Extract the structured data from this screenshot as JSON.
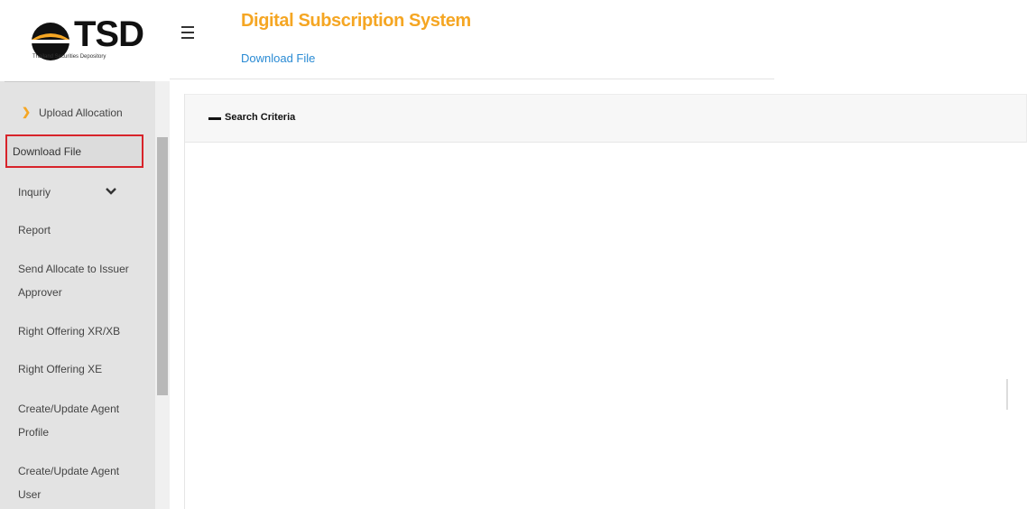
{
  "header": {
    "logo_text": "TSD",
    "logo_subtext": "Thailand Securities Depository",
    "app_title": "Digital Subscription System",
    "breadcrumb": "Download File"
  },
  "sidebar": {
    "items": [
      {
        "label": "Upload Allocation",
        "icon": "chevron-right-icon",
        "sub": true
      },
      {
        "label": "Download File",
        "active": true
      },
      {
        "label": "Inquriy",
        "icon": "chevron-down-icon"
      },
      {
        "label": "Report"
      },
      {
        "label_line1": "Send Allocate to Issuer",
        "label_line2": "Approver"
      },
      {
        "label": "Right Offering XR/XB"
      },
      {
        "label": "Right Offering XE"
      },
      {
        "label_line1": "Create/Update Agent",
        "label_line2": "Profile"
      },
      {
        "label_line1": "Create/Update Agent",
        "label_line2": "User"
      }
    ]
  },
  "main": {
    "panel_title": "Search Criteria",
    "panel_toggle_icon": "minus-icon"
  },
  "colors": {
    "accent": "#f5a623",
    "link": "#2a8bd4",
    "highlight_border": "#d8232a",
    "sidebar_bg": "#e3e3e3"
  }
}
